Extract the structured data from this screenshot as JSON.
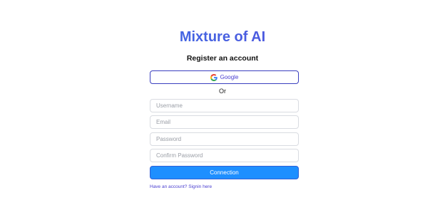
{
  "brand": {
    "title": "Mixture of AI"
  },
  "register": {
    "heading": "Register an account",
    "google_label": "Google",
    "divider_text": "Or",
    "fields": {
      "username_placeholder": "Username",
      "email_placeholder": "Email",
      "password_placeholder": "Password",
      "confirm_password_placeholder": "Confirm Password"
    },
    "submit_label": "Connection",
    "signin_link": "Have an account? Signin here"
  },
  "colors": {
    "brand_gradient_start": "#2f7be8",
    "brand_gradient_end": "#5a3fd6",
    "primary_button": "#1e8fff",
    "google_border": "#3a3fbf",
    "link": "#4a3fd0"
  },
  "icons": {
    "google": "google-icon"
  }
}
